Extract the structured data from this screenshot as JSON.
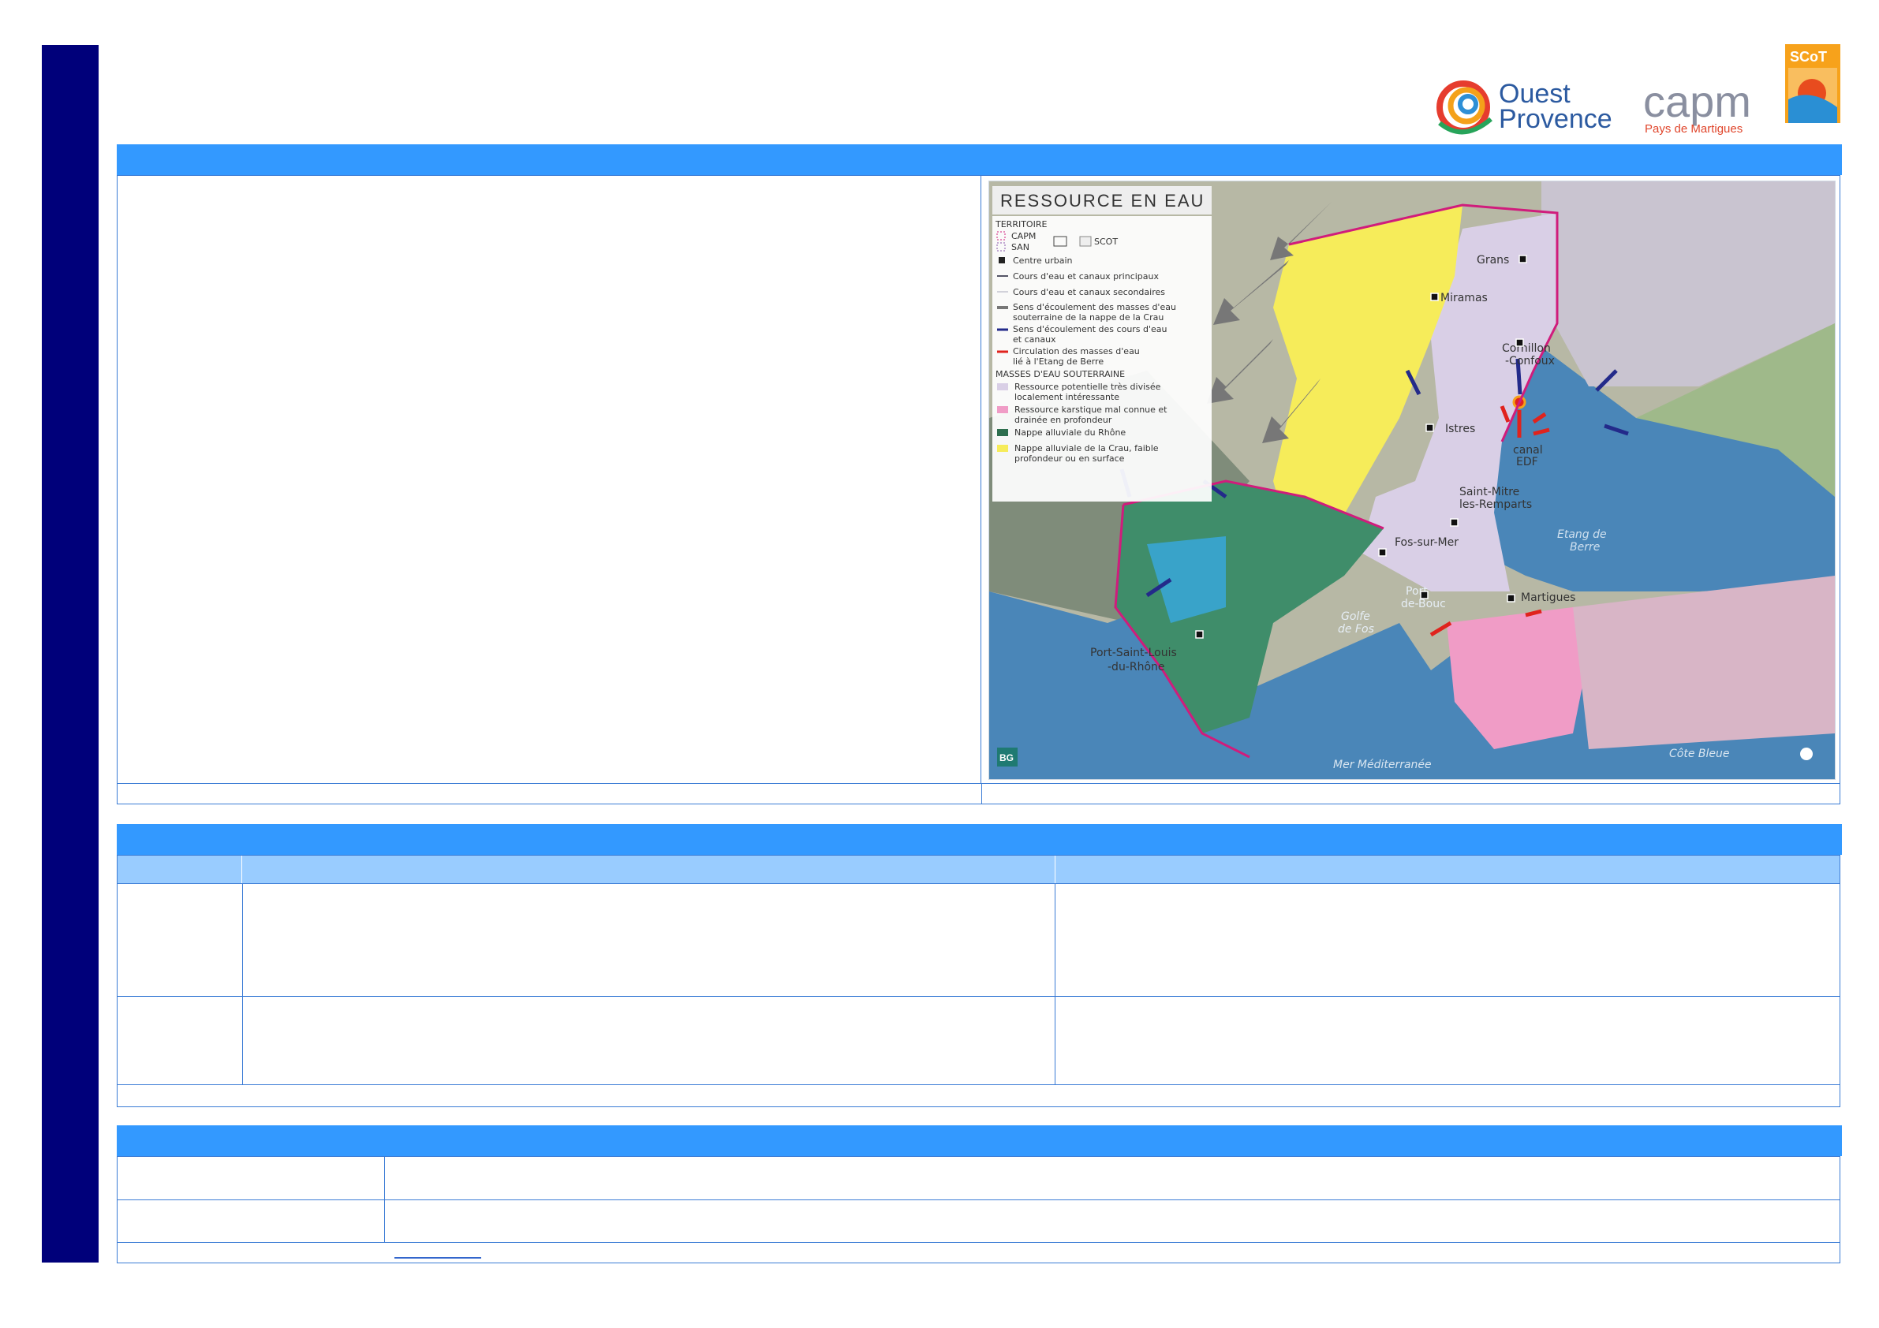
{
  "logos": {
    "ouest_provence_line1": "Ouest",
    "ouest_provence_line2": "Provence",
    "capm": "capm",
    "capm_sub": "Pays de Martigues",
    "scot": "SCoT"
  },
  "map": {
    "title": "RESSOURCE EN EAU",
    "legend": {
      "territoire": "TERRITOIRE",
      "capm": "CAPM",
      "san": "SAN",
      "scot": "SCOT",
      "centre_urbain": "Centre urbain",
      "cours_principaux": "Cours d'eau et canaux principaux",
      "cours_secondaires": "Cours d'eau et canaux secondaires",
      "sens_nappe_1": "Sens d'écoulement des masses d'eau",
      "sens_nappe_2": "souterraine de la nappe de la Crau",
      "sens_cours_1": "Sens d'écoulement des cours d'eau",
      "sens_cours_2": "et canaux",
      "circulation_1": "Circulation des masses d'eau",
      "circulation_2": "lié à l'Etang de Berre",
      "masses": "MASSES D'EAU SOUTERRAINE",
      "ress_divisee_1": "Ressource potentielle très divisée",
      "ress_divisee_2": "localement intéressante",
      "ress_karst_1": "Ressource karstique mal connue et",
      "ress_karst_2": "drainée en profondeur",
      "nappe_rhone": "Nappe alluviale du Rhône",
      "nappe_crau_1": "Nappe alluviale de la Crau, faible",
      "nappe_crau_2": "profondeur ou en surface"
    },
    "places": {
      "grans": "Grans",
      "miramas": "Miramas",
      "cornillon_1": "Cornillon",
      "cornillon_2": "-Confoux",
      "canal_edf_1": "canal",
      "canal_edf_2": "EDF",
      "istres": "Istres",
      "saint_mitre_1": "Saint-Mitre",
      "saint_mitre_2": "les-Remparts",
      "etang_1": "Etang de",
      "etang_2": "Berre",
      "fos": "Fos-sur-Mer",
      "port_de_bouc_1": "Port",
      "port_de_bouc_2": "de-Bouc",
      "golfe_1": "Golfe",
      "golfe_2": "de Fos",
      "martigues": "Martigues",
      "port_st_louis_1": "Port-Saint-Louis",
      "port_st_louis_2": "-du-Rhône",
      "mer": "Mer Méditerranée",
      "cote_bleue": "Côte Bleue"
    },
    "logo_bg": "BG"
  },
  "colors": {
    "sidebar": "#00007a",
    "band": "#3399ff",
    "subheader": "#99ccff",
    "border": "#3a7bd5"
  }
}
